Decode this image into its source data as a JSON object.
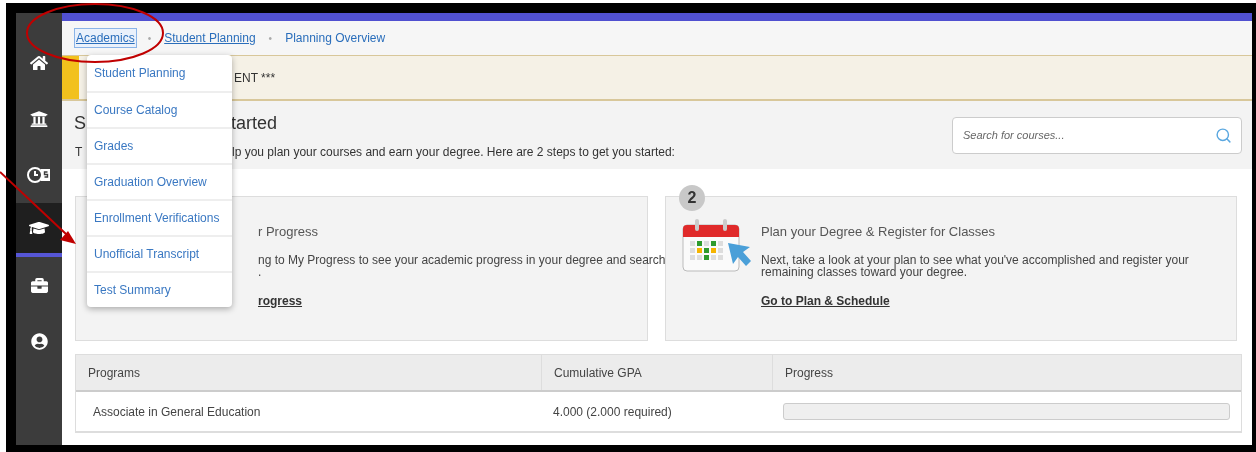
{
  "sidebar": {
    "items": [
      {
        "kind": "home",
        "selected": false
      },
      {
        "kind": "bank",
        "selected": false
      },
      {
        "kind": "finance",
        "selected": false
      },
      {
        "kind": "academics",
        "selected": true
      },
      {
        "kind": "work",
        "selected": false
      },
      {
        "kind": "profile",
        "selected": false
      }
    ]
  },
  "breadcrumb": [
    {
      "label": "Academics",
      "selected": true
    },
    {
      "separator": "•",
      "label": "Student Planning",
      "selected": false
    },
    {
      "separator": "•",
      "label": "Planning Overview",
      "selected": false
    }
  ],
  "dropdown": {
    "items": [
      "Student Planning",
      "Course Catalog",
      "Grades",
      "Graduation Overview",
      "Enrollment Verifications",
      "Unofficial Transcript",
      "Test Summary"
    ]
  },
  "banner": {
    "text": "ENT ***"
  },
  "header": {
    "title_left": "S",
    "title_right": "tarted",
    "subtitle_left": "T",
    "subtitle_right": "lp you plan your courses and earn your degree. Here are 2 steps to get you started:"
  },
  "search": {
    "placeholder": "Search for courses..."
  },
  "cards": [
    {
      "title": "r Progress",
      "body": [
        "ng to My Progress to see your academic progress in your degree and search",
        "."
      ],
      "link": "rogress"
    },
    {
      "step": "2",
      "title": "Plan your Degree & Register for Classes",
      "body": [
        "Next, take a look at your plan to see what you've accomplished and register your",
        "remaining classes toward your degree."
      ],
      "link": "Go to Plan & Schedule"
    }
  ],
  "table": {
    "columns": [
      "Programs",
      "Cumulative GPA",
      "Progress"
    ],
    "rows": [
      {
        "program": "Associate in General Education",
        "gpa": "4.000 (2.000 required)",
        "level": 0
      }
    ]
  }
}
